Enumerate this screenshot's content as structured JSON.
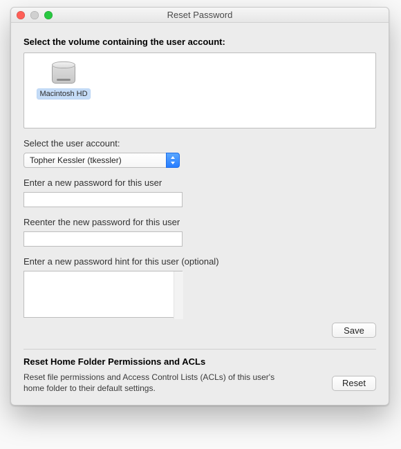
{
  "window": {
    "title": "Reset Password"
  },
  "volumes": {
    "heading": "Select the volume containing the user account:",
    "items": [
      {
        "label": "Macintosh HD",
        "selected": true
      }
    ]
  },
  "account": {
    "label": "Select the user account:",
    "selected": "Topher Kessler (tkessler)",
    "options": [
      "Topher Kessler (tkessler)"
    ]
  },
  "new_password": {
    "label": "Enter a new password for this user",
    "value": ""
  },
  "reenter_password": {
    "label": "Reenter the new password for this user",
    "value": ""
  },
  "hint": {
    "label": "Enter a new password hint for this user (optional)",
    "value": ""
  },
  "buttons": {
    "save": "Save",
    "reset": "Reset"
  },
  "acls": {
    "heading": "Reset Home Folder Permissions and ACLs",
    "description": "Reset file permissions and Access Control Lists (ACLs) of this user's home folder to their default settings."
  },
  "icons": {
    "internal_disk": "internal-disk-icon",
    "select_arrows": "chevrons-up-down-icon"
  }
}
